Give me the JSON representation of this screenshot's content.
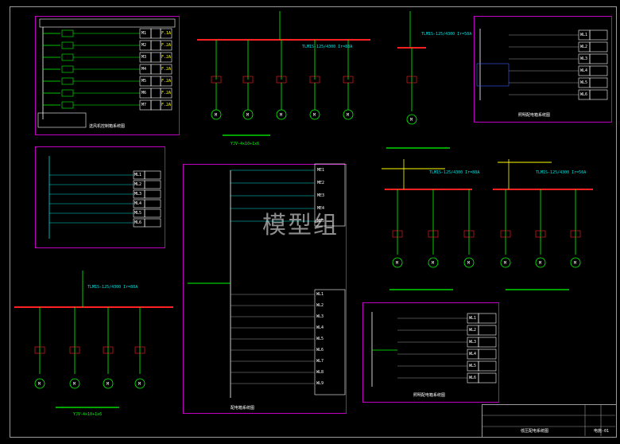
{
  "watermark": "模型组",
  "colors": {
    "background": "#000000",
    "frame": "#c000c0",
    "busbar": "#ff2020",
    "wire": "#00ff00",
    "cyan": "#00e0e0",
    "yellow": "#ffff00",
    "blue": "#3c5cff",
    "grey": "#9a9a9a"
  },
  "panels": {
    "p1": {
      "rows": [
        "M1",
        "M2",
        "M3",
        "M4",
        "M5",
        "M6",
        "M7"
      ],
      "cells": [
        "F.1A",
        "F.2A",
        "F.2A",
        "F.2A",
        "F.2A",
        "F.2A",
        "F.2A"
      ],
      "caption": "送风机控制箱系统图"
    },
    "p2": {
      "rows": [
        "WL1",
        "WL2",
        "WL3",
        "WL4",
        "WL5",
        "WL6"
      ],
      "caption": "照明配电箱系统图"
    },
    "p3": {
      "rows": [
        "ML1",
        "ML2",
        "ML3",
        "ML4",
        "ML5",
        "ML6"
      ]
    },
    "center": {
      "rows_top": [
        "ME1",
        "ME2",
        "ME3",
        "ME4",
        "ME5"
      ],
      "rows_bottom": [
        "WL1",
        "WL2",
        "WL3",
        "WL4",
        "WL5",
        "WL6",
        "WL7",
        "WL8",
        "WL9"
      ],
      "caption": "配电箱系统图"
    },
    "p4": {
      "rows": [
        "WL1",
        "WL2",
        "WL3",
        "WL4",
        "WL5",
        "WL6"
      ],
      "caption": "照明配电箱系统图"
    }
  },
  "motor_label": "M",
  "breaker_label_1": "TLM1S-125/4300 Ir=80A",
  "breaker_label_2": "TLM1S-125/4300 Ir=50A",
  "cable_label": "YJV-4x10+1x6",
  "titleblock": {
    "project": "低压配电系统图",
    "sheet": "电施-01"
  }
}
